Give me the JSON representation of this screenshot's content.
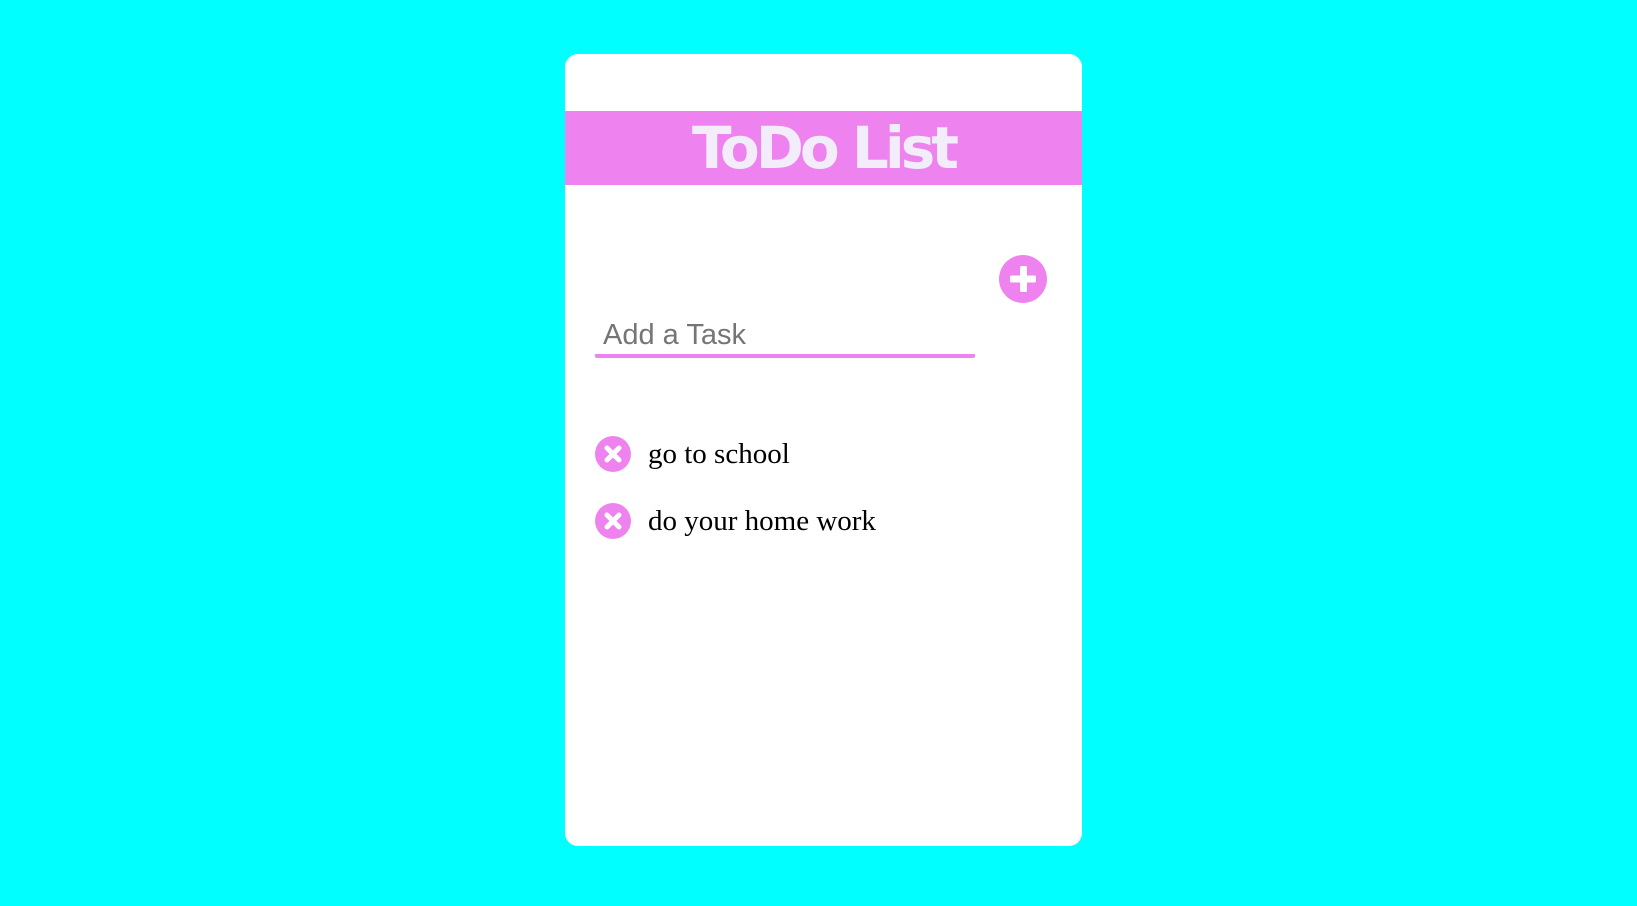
{
  "app": {
    "title": "ToDo List"
  },
  "input": {
    "placeholder": "Add a Task",
    "value": ""
  },
  "tasks": [
    {
      "label": "go to school"
    },
    {
      "label": "do your home work"
    }
  ],
  "icons": {
    "add": "plus-icon",
    "remove": "close-icon"
  },
  "colors": {
    "background": "#00ffff",
    "accent": "#ee82ee",
    "title_text": "#f3ecfb",
    "card": "#ffffff"
  }
}
